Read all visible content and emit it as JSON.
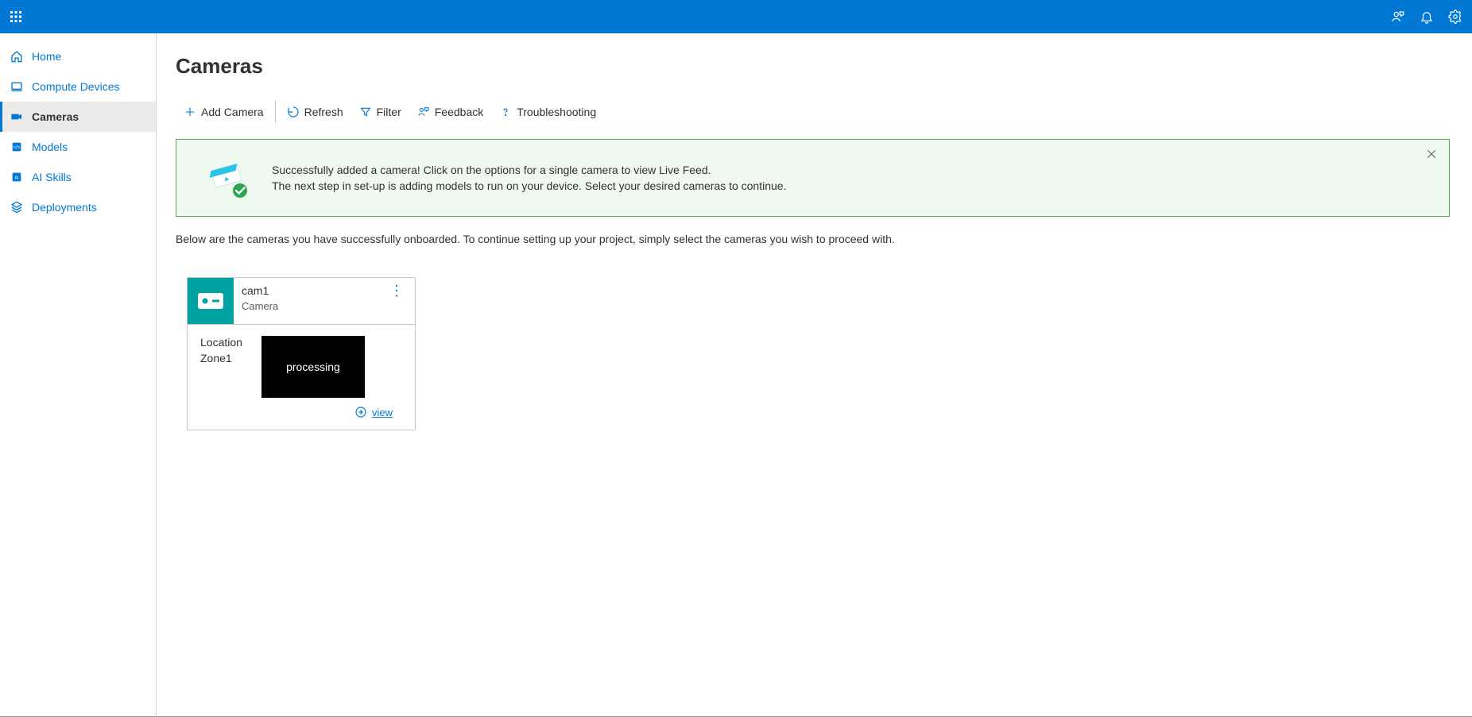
{
  "sidebar": {
    "items": [
      {
        "label": "Home"
      },
      {
        "label": "Compute Devices"
      },
      {
        "label": "Cameras"
      },
      {
        "label": "Models"
      },
      {
        "label": "AI Skills"
      },
      {
        "label": "Deployments"
      }
    ]
  },
  "page": {
    "title": "Cameras"
  },
  "toolbar": {
    "add": "Add Camera",
    "refresh": "Refresh",
    "filter": "Filter",
    "feedback": "Feedback",
    "troubleshoot": "Troubleshooting"
  },
  "banner": {
    "line1": "Successfully added a camera! Click on the options for a single camera to view Live Feed.",
    "line2": "The next step in set-up is adding models to run on your device. Select your desired cameras to continue."
  },
  "description": "Below are the cameras you have successfully onboarded. To continue setting up your project, simply select the cameras you wish to proceed with.",
  "camera": {
    "name": "cam1",
    "type": "Camera",
    "location_label": "Location",
    "location_value": "Zone1",
    "preview_status": "processing",
    "view_link": "view"
  }
}
